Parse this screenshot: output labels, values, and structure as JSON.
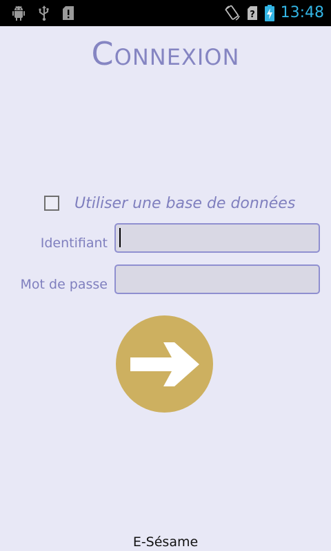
{
  "status_bar": {
    "time": "13:48",
    "left_icons": [
      "android-debug-icon",
      "usb-icon",
      "sd-card-warning-icon"
    ],
    "right_icons": [
      "rotate-icon",
      "no-signal-icon",
      "battery-charging-icon"
    ],
    "time_color": "#33b5e5"
  },
  "page": {
    "title": "Connexion",
    "checkbox_label": "Utiliser une base de données",
    "checkbox_checked": false,
    "identifiant_label": "Identifiant",
    "identifiant_value": "",
    "password_label": "Mot de passe",
    "password_value": "",
    "submit_icon": "arrow-right-icon",
    "footer": "E-Sésame"
  },
  "colors": {
    "background": "#e8e8f6",
    "accent": "#8585c2",
    "input_border": "#8f8fd0",
    "input_bg": "#d9d8e4",
    "button": "#cdb060"
  }
}
